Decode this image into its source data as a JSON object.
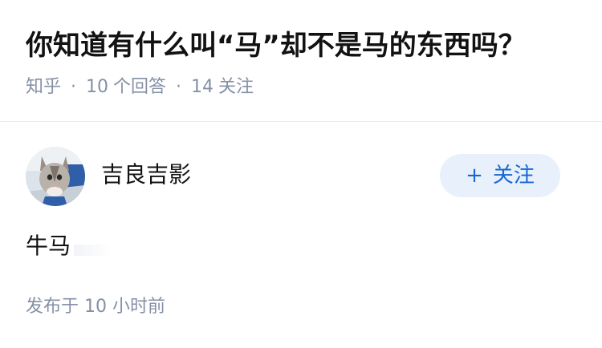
{
  "question": {
    "title": "你知道有什么叫“马”却不是马的东西吗？",
    "meta": {
      "source": "知乎",
      "separator": "·",
      "answers_count": "10",
      "answers_label": "个回答",
      "followers_count": "14",
      "followers_label": "关注"
    }
  },
  "answer": {
    "author": {
      "name": "吉良吉影",
      "avatar": "cat-avatar"
    },
    "follow_button": {
      "icon": "+",
      "label": "关注"
    },
    "content": "牛马",
    "publish": {
      "label": "发布于",
      "time": "10 小时前"
    }
  },
  "colors": {
    "title": "#121212",
    "meta": "#8590a6",
    "follow_bg": "#e8f1fb",
    "follow_text": "#1766d6",
    "divider": "#ebebeb"
  }
}
